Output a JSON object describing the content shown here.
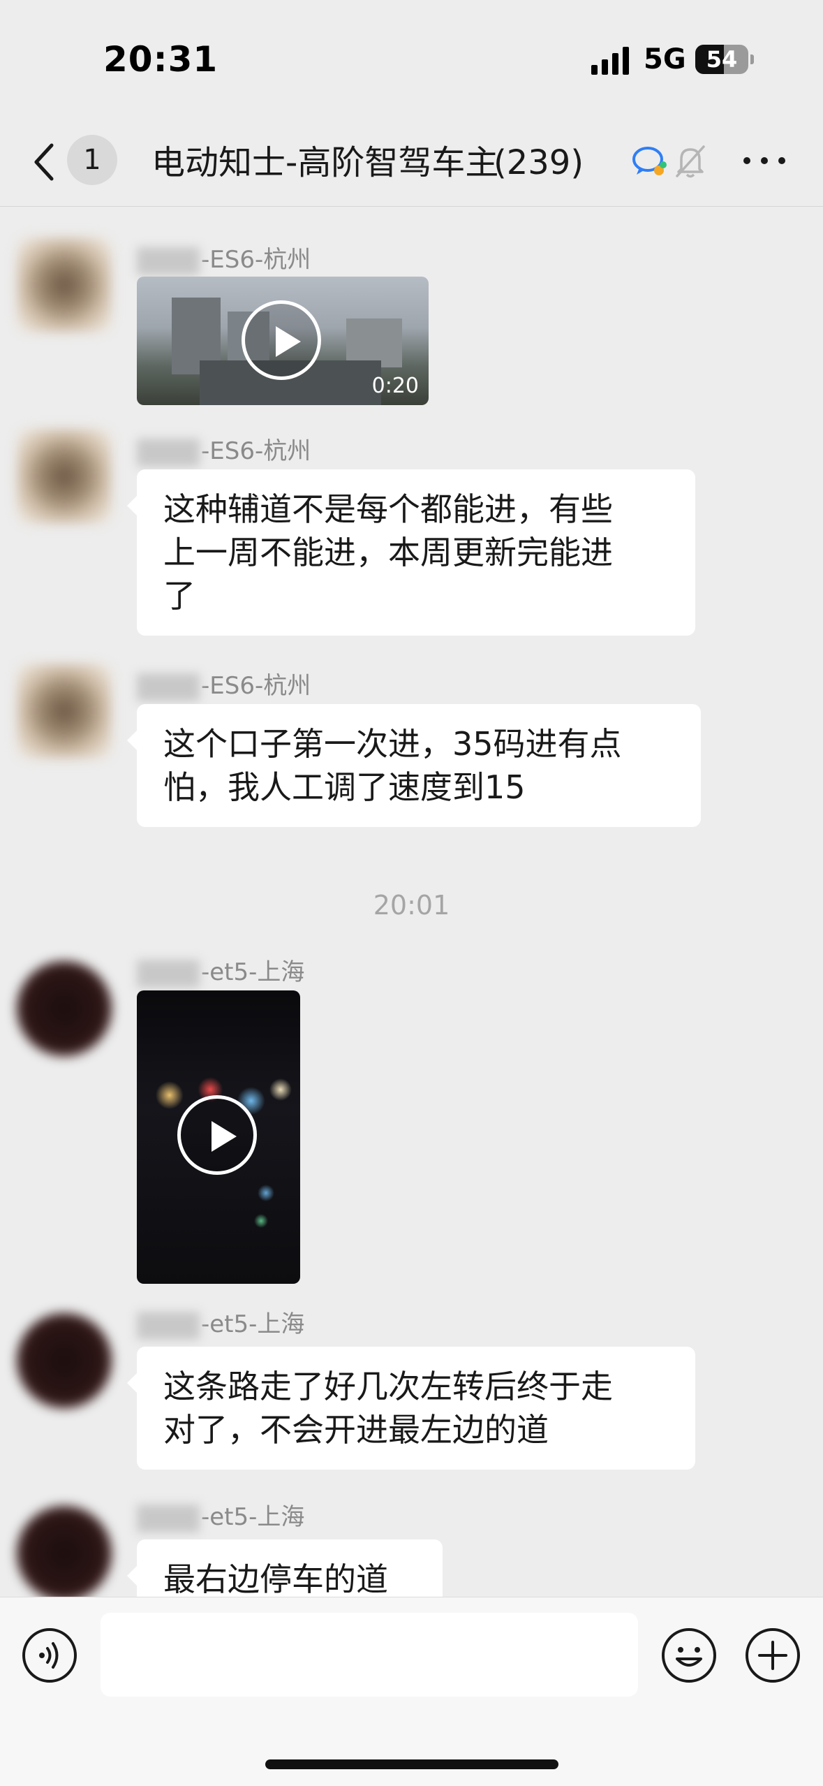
{
  "status_bar": {
    "time": "20:31",
    "network": "5G",
    "battery_level": "54",
    "battery_fraction": 0.54
  },
  "nav": {
    "unread_count": "1",
    "title": "电动知士-高阶智驾车主",
    "member_count": "(239)",
    "icons": {
      "back": "chevron-left-icon",
      "enterprise": "enterprise-chat-icon",
      "mute": "bell-muted-icon",
      "more": "more-dots-icon"
    }
  },
  "messages": [
    {
      "sender_suffix": "-ES6-杭州",
      "type": "video",
      "duration": "0:20"
    },
    {
      "sender_suffix": "-ES6-杭州",
      "type": "text",
      "lines": [
        "这种辅道不是每个都能进，有些",
        "上一周不能进，本周更新完能进",
        "了"
      ]
    },
    {
      "sender_suffix": "-ES6-杭州",
      "type": "text",
      "lines": [
        "这个口子第一次进，35码进有点",
        "怕，我人工调了速度到15"
      ]
    },
    {
      "sender_suffix": "-et5-上海",
      "type": "video",
      "duration": ""
    },
    {
      "sender_suffix": "-et5-上海",
      "type": "text",
      "lines": [
        "这条路走了好几次左转后终于走",
        "对了，不会开进最左边的道"
      ]
    },
    {
      "sender_suffix": "-et5-上海",
      "type": "text",
      "lines": [
        "最右边停车的道"
      ]
    }
  ],
  "time_divider": "20:01",
  "input_bar": {
    "placeholder": "",
    "icons": {
      "voice": "voice-icon",
      "emoji": "emoji-icon",
      "plus": "plus-icon"
    }
  },
  "colors": {
    "background": "#ededed",
    "bubble": "#ffffff",
    "sender_name": "#8a8a8a",
    "time_divider": "#a5a5a5"
  }
}
